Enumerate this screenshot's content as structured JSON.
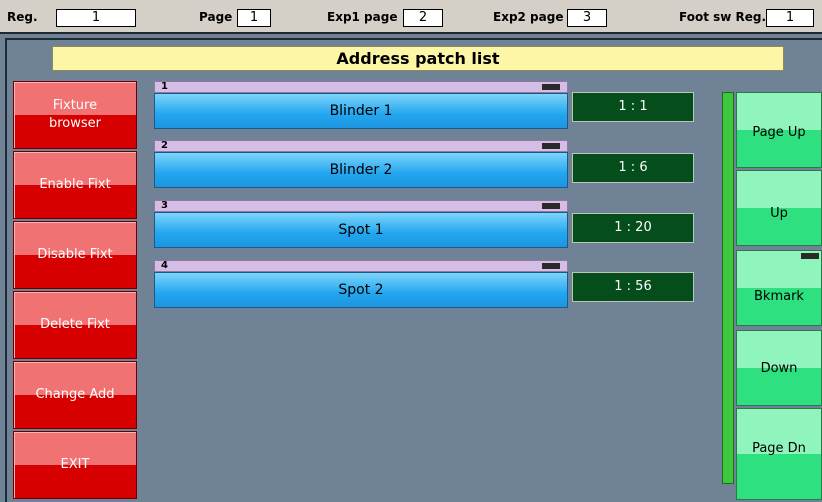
{
  "topbar": {
    "reg_label": "Reg.",
    "reg_value": "1",
    "page_label": "Page",
    "page_value": "1",
    "exp1_label": "Exp1 page",
    "exp1_value": "2",
    "exp2_label": "Exp2 page",
    "exp2_value": "3",
    "foot_label": "Foot sw Reg.",
    "foot_value": "1"
  },
  "title": "Address patch list",
  "left_buttons": [
    {
      "line1": "Fixture",
      "line2": "browser"
    },
    {
      "line1": "Enable Fixt",
      "line2": ""
    },
    {
      "line1": "Disable Fixt",
      "line2": ""
    },
    {
      "line1": "Delete Fixt",
      "line2": ""
    },
    {
      "line1": "Change Add",
      "line2": ""
    },
    {
      "line1": "EXIT",
      "line2": ""
    }
  ],
  "fixtures": [
    {
      "num": "1",
      "name": "Blinder 1",
      "address": "1 : 1"
    },
    {
      "num": "2",
      "name": "Blinder 2",
      "address": "1 : 6"
    },
    {
      "num": "3",
      "name": "Spot 1",
      "address": "1 : 20"
    },
    {
      "num": "4",
      "name": "Spot 2",
      "address": "1 : 56"
    }
  ],
  "right_buttons": {
    "page_up": "Page Up",
    "up": "Up",
    "bkmark": "Bkmark",
    "down": "Down",
    "page_dn": "Page Dn"
  },
  "colors": {
    "background": "#6f8296",
    "red_button": "#d70000",
    "fixture_blue": "#22a6ef",
    "address_green": "#064d1c",
    "nav_green": "#2ee07f",
    "title_yellow": "#fdf6a6"
  }
}
